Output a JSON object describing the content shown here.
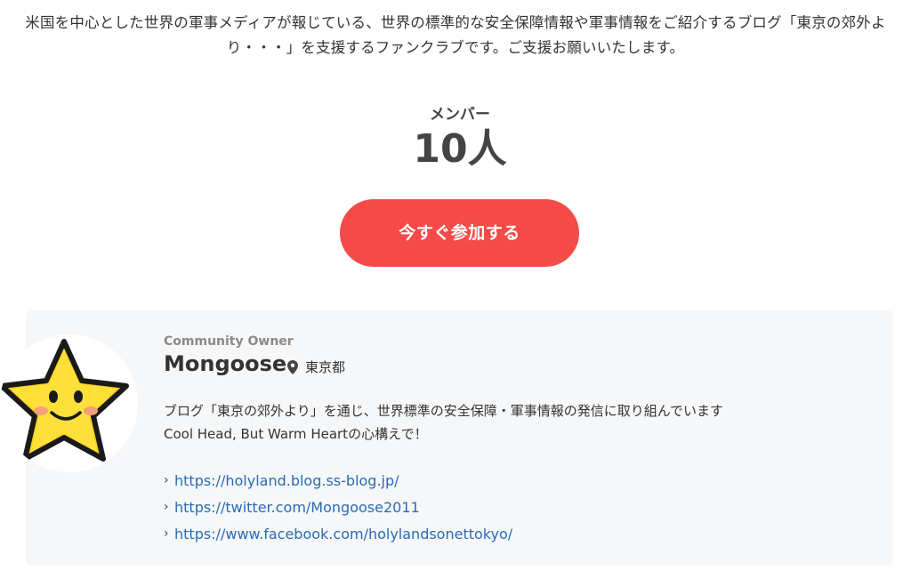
{
  "description": "米国を中心とした世界の軍事メディアが報じている、世界の標準的な安全保障情報や軍事情報をご紹介するブログ「東京の郊外より・・・」を支援するファンクラブです。ご支援お願いいたします。",
  "members": {
    "label": "メンバー",
    "count": "10人"
  },
  "join_button": {
    "label": "今すぐ参加する"
  },
  "owner": {
    "role": "Community Owner",
    "name": "Mongoose",
    "location": "東京都",
    "bio_line1": "ブログ「東京の郊外より」を通じ、世界標準の安全保障・軍事情報の発信に取り組んでいます",
    "bio_line2": "Cool Head, But Warm Heartの心構えで！",
    "links": [
      {
        "text": "https://holyland.blog.ss-blog.jp/"
      },
      {
        "text": "https://twitter.com/Mongoose2011"
      },
      {
        "text": "https://www.facebook.com/holylandsonettokyo/"
      }
    ]
  },
  "colors": {
    "accent": "#f54b48",
    "link": "#2a6bb3",
    "card_bg": "#f5f7f9"
  },
  "icons": {
    "location": "map-pin-icon",
    "link_arrow": "chevron-right-icon",
    "avatar": "smiling-star-avatar"
  }
}
